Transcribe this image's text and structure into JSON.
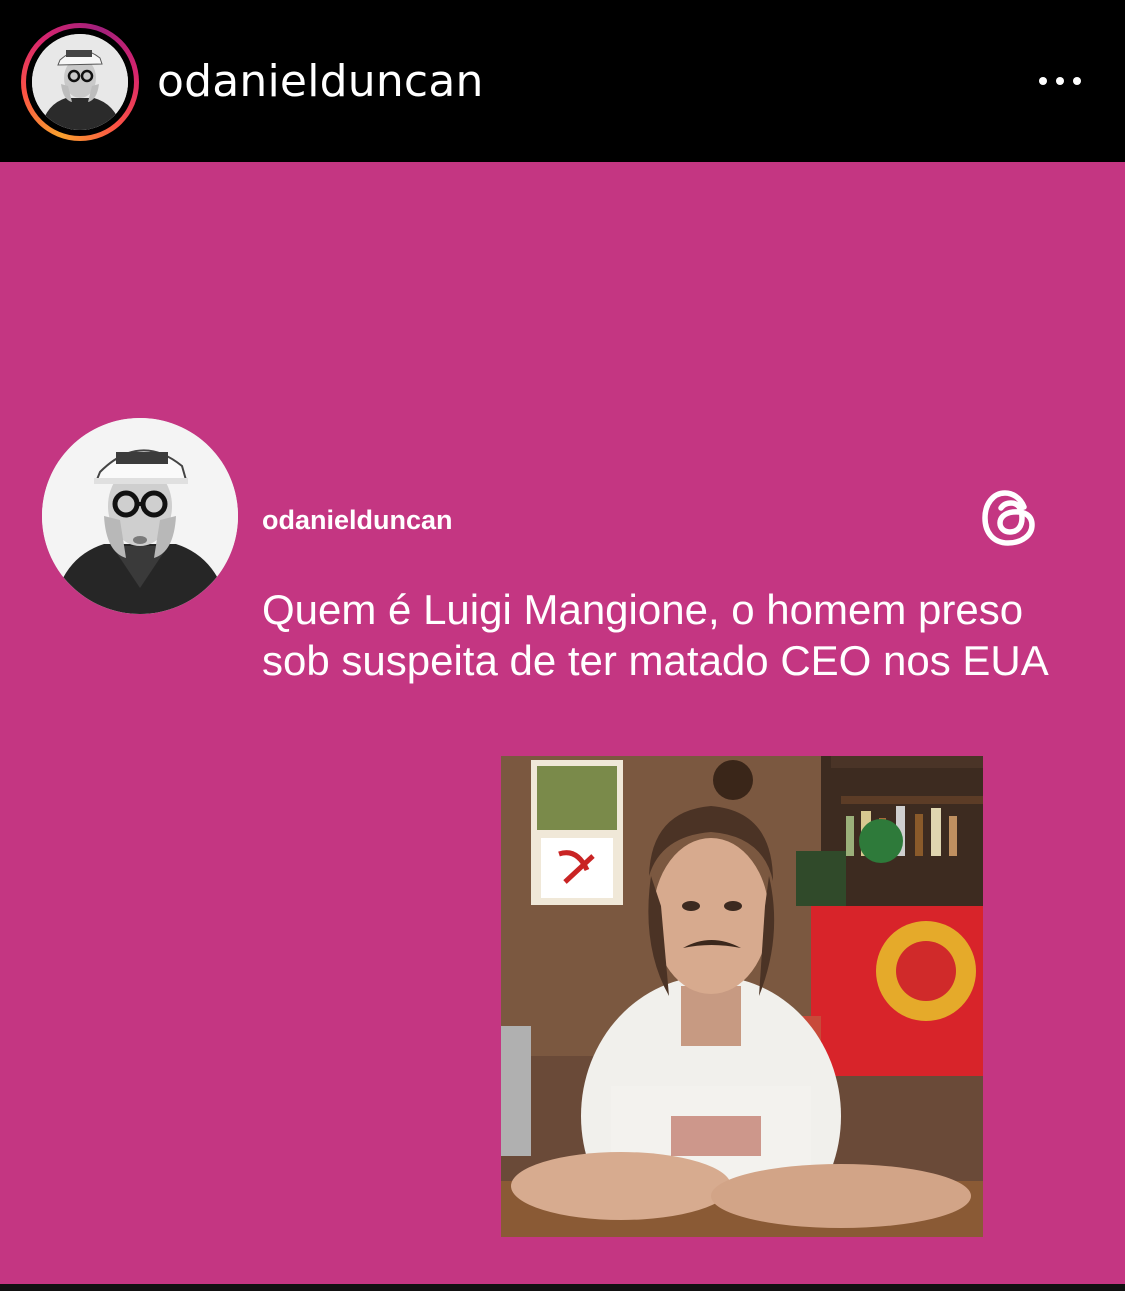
{
  "story": {
    "username": "odanielduncan",
    "avatar_icon": "profile-photo",
    "more_icon": "more-horizontal-icon"
  },
  "post": {
    "username": "odanielduncan",
    "platform_icon": "threads-logo-icon",
    "text": "Quem é Luigi Mangione, o homem preso sob suspeita de ter matado CEO nos EUA",
    "photo": "photo of man in white t-shirt leaning on bar counter"
  },
  "colors": {
    "background": "#c43682",
    "header": "#000000",
    "text": "#ffffff"
  }
}
